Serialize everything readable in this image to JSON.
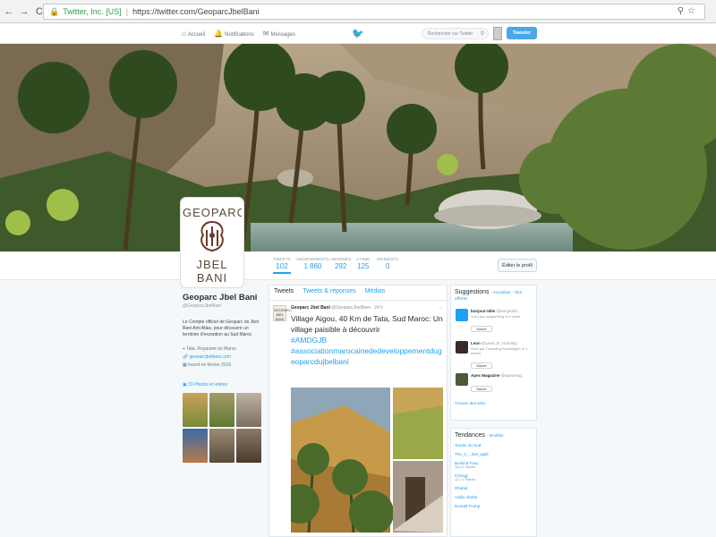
{
  "browser": {
    "nav": {
      "back": "←",
      "forward": "→",
      "reload": "C"
    },
    "secure_label": "Twitter, Inc. [US]",
    "url": "https://twitter.com/GeoparcJbelBani"
  },
  "topnav": {
    "home": "Accueil",
    "notifications": "Notifications",
    "messages": "Messages",
    "search_placeholder": "Rechercher sur Twitter",
    "tweet_button": "Tweeter"
  },
  "stats": [
    {
      "label": "TWEETS",
      "value": "102"
    },
    {
      "label": "ABONNEMENTS",
      "value": "1 860"
    },
    {
      "label": "ABONNÉS",
      "value": "292"
    },
    {
      "label": "J'AIME",
      "value": "125"
    },
    {
      "label": "MOMENTS",
      "value": "0"
    }
  ],
  "edit_profile": "Éditer le profil",
  "avatar": {
    "line1": "GEOPARC",
    "line2": "JBEL BANI"
  },
  "profile": {
    "name": "Geoparc Jbel Bani",
    "handle": "@GeoparcJbelBani",
    "bio": "Le Compte officiel de Geoparc du Jbel Bani Anti Atlas, pour découvrir un territoire d'exception au Sud Maroc",
    "location": "Tata, Royaume du Maroc",
    "website": "geoparcjbelbani.com",
    "joined": "Inscrit en février 2016",
    "photos_link": "33 Photos et vidéos"
  },
  "timeline": {
    "tabs": [
      "Tweets",
      "Tweets & réponses",
      "Médias"
    ],
    "tweet": {
      "author": "Geoparc Jbel Bani",
      "handle": "@GeoparcJbelBani · 24 h",
      "text": "Village Aigou, 40 Km de Tata, Sud Maroc: Un village paisible à découvrir",
      "tag1": "#AMDGJB",
      "tag2": "#associationmarocainededeveloppementdugeoparcdujbelbani"
    }
  },
  "suggestions": {
    "title": "Suggestions",
    "refresh": "· Actualiser · Tout afficher",
    "items": [
      {
        "name": "bonjour-idée",
        "handle": "@bonjourid…",
        "sub": "Suivi par sosparming et 1 autre",
        "action": "Suivre"
      },
      {
        "name": "Leon",
        "handle": "@Leon_R_Hornsby",
        "sub": "Suivi par Travelling Roadtripper et 1 autres",
        "action": "Suivre"
      },
      {
        "name": "Apex Magazine",
        "handle": "@apexmag",
        "sub": "",
        "action": "Suivre"
      }
    ],
    "find_friends": "Trouver des amis"
  },
  "trends": {
    "title": "Tendances",
    "change": "· Modifier",
    "items": [
      {
        "name": "Teodor du Sud",
        "sub": ""
      },
      {
        "name": "The_4_...ibel_iqalil",
        "sub": ""
      },
      {
        "name": "Burkina Faso",
        "sub": "28,2 k Tweets"
      },
      {
        "name": "#Ahogy",
        "sub": "12,7 k Tweets"
      },
      {
        "name": "#Rabat",
        "sub": ""
      },
      {
        "name": "Addis Abeba",
        "sub": ""
      },
      {
        "name": "Donald Trump",
        "sub": ""
      }
    ]
  },
  "colors": {
    "accent": "#1da1f2",
    "page_bg": "#f5f8fa"
  }
}
